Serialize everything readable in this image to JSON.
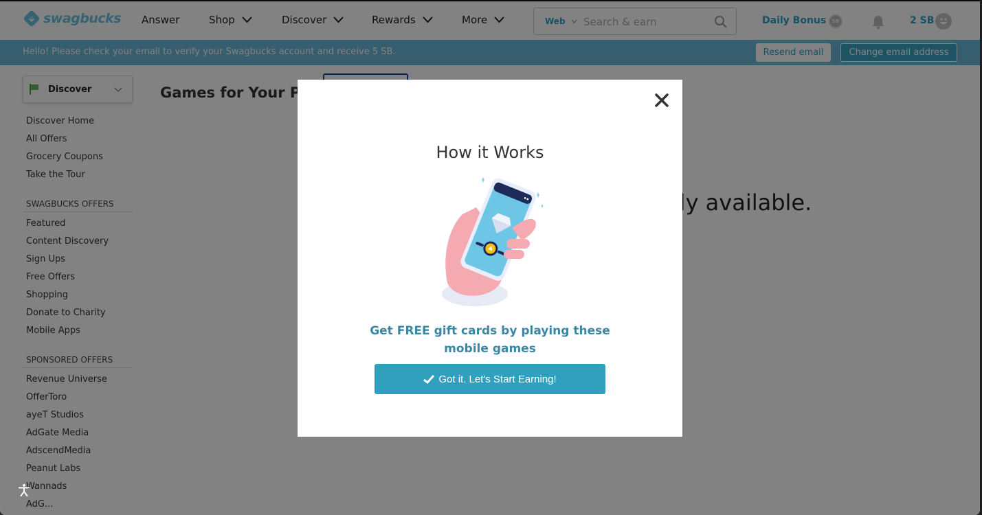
{
  "header": {
    "logo_text": "swagbucks",
    "nav": [
      {
        "label": "Answer",
        "has_dropdown": false
      },
      {
        "label": "Shop",
        "has_dropdown": true
      },
      {
        "label": "Discover",
        "has_dropdown": true
      },
      {
        "label": "Rewards",
        "has_dropdown": true
      },
      {
        "label": "More",
        "has_dropdown": true
      }
    ],
    "search": {
      "scope": "Web",
      "placeholder": "Search & earn",
      "value": ""
    },
    "daily_bonus": "Daily Bonus",
    "coin_label": "SB",
    "sb_balance": "2 SB"
  },
  "banner": {
    "message": "Hello! Please check your email to verify your Swagbucks account and receive 5 SB.",
    "resend_label": "Resend email",
    "change_label": "Change email address"
  },
  "sidebar": {
    "selector_label": "Discover",
    "main_links": [
      "Discover Home",
      "All Offers",
      "Grocery Coupons",
      "Take the Tour"
    ],
    "swagbucks_offers_heading": "SWAGBUCKS OFFERS",
    "swagbucks_offers": [
      "Featured",
      "Content Discovery",
      "Sign Ups",
      "Free Offers",
      "Shopping",
      "Donate to Charity",
      "Mobile Apps"
    ],
    "sponsored_offers_heading": "SPONSORED OFFERS",
    "sponsored_offers": [
      "Revenue Universe",
      "OfferToro",
      "ayeT Studios",
      "AdGate Media",
      "AdscendMedia",
      "Peanut Labs",
      "Wannads",
      "AdG..."
    ]
  },
  "main": {
    "page_title": "Games for Your Phone",
    "empty_message": "No games are currently available."
  },
  "modal": {
    "title": "How it Works",
    "description": "Get FREE gift cards by playing these mobile games",
    "cta_label": "Got it. Let's Start Earning!"
  },
  "colors": {
    "brand": "#6cc0de",
    "accent": "#2e9fc0",
    "banner": "#6bb9d8",
    "cta": "#31a0bf",
    "desc_text": "#3a88a5"
  }
}
